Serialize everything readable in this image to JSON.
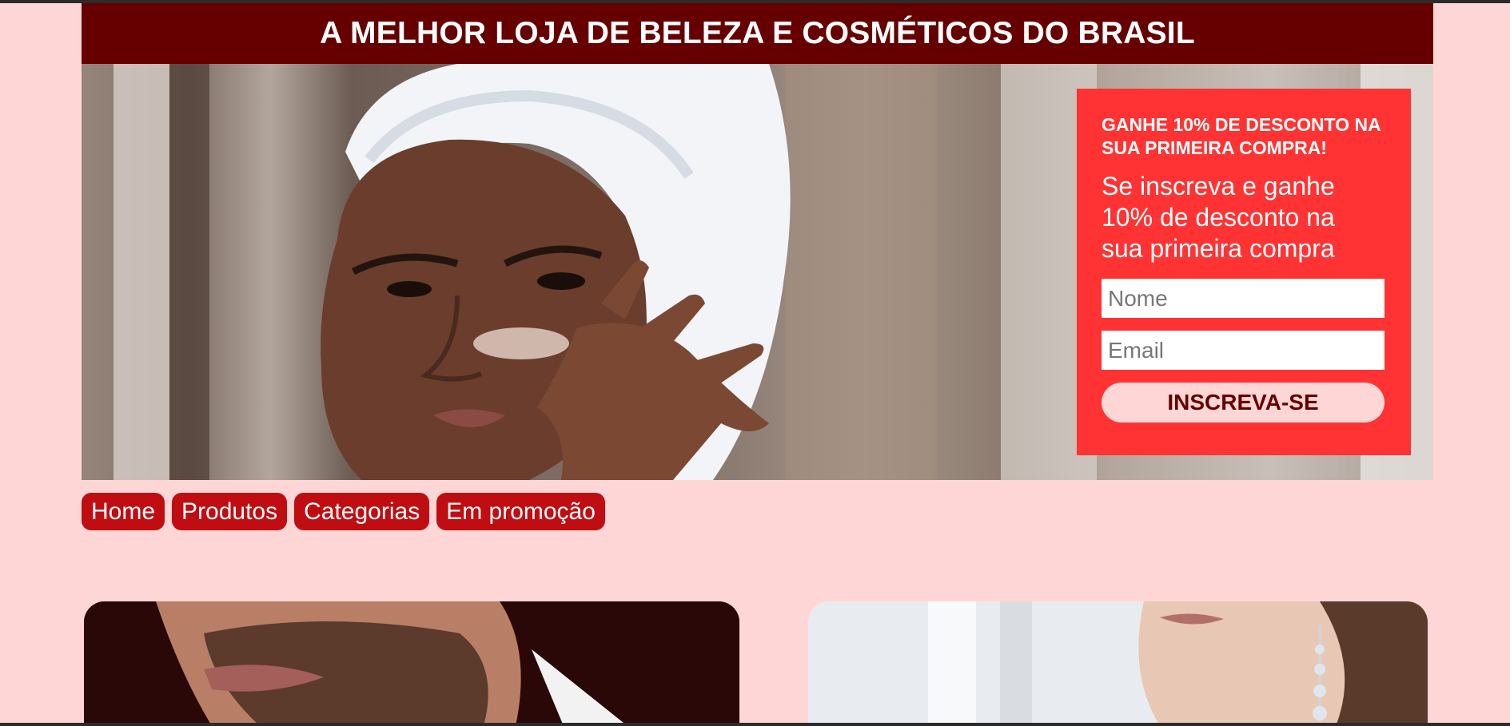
{
  "header": {
    "banner_title": "A MELHOR LOJA DE BELEZA E COSMÉTICOS DO BRASIL"
  },
  "hero": {
    "image_label": "woman-applying-cream-photo"
  },
  "signup": {
    "heading": "GANHE 10% DE DESCONTO NA SUA PRIMEIRA COMPRA!",
    "text": "Se inscreva e ganhe 10% de desconto na sua primeira compra",
    "name_placeholder": "Nome",
    "email_placeholder": "Email",
    "button_label": "INSCREVA-SE"
  },
  "nav": {
    "items": [
      {
        "label": "Home"
      },
      {
        "label": "Produtos"
      },
      {
        "label": "Categorias"
      },
      {
        "label": "Em promoção"
      }
    ]
  },
  "cards": [
    {
      "image_label": "man-beard-photo"
    },
    {
      "image_label": "woman-earring-photo"
    }
  ],
  "colors": {
    "page_background": "#ffd6d6",
    "banner_background": "#660000",
    "signup_background": "#ff3333",
    "nav_button": "#c00d12",
    "signup_button_text": "#660000"
  }
}
